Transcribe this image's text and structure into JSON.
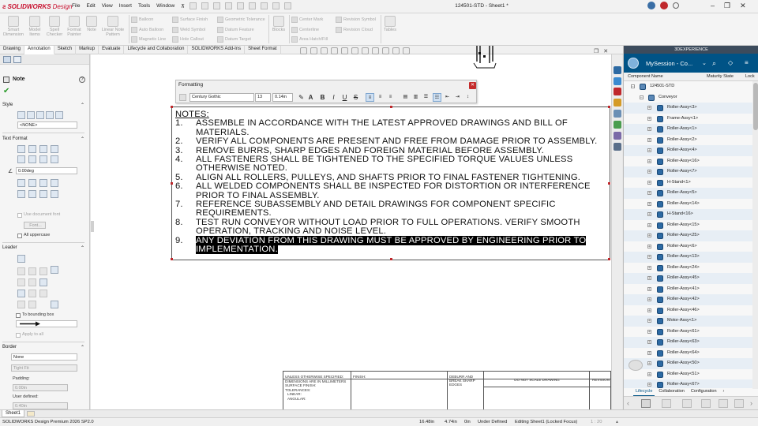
{
  "app": {
    "brand": "SOLIDWORKS",
    "brand_suffix": "Design",
    "menus": [
      "File",
      "Edit",
      "View",
      "Insert",
      "Tools",
      "Window"
    ],
    "document_title": "124501-STD - Sheet1 *"
  },
  "command_manager": {
    "buttons": [
      {
        "label": "Smart Dimension"
      },
      {
        "label": "Model Items"
      },
      {
        "label": "Spell Checker"
      },
      {
        "label": "Format Painter"
      },
      {
        "label": "Note"
      },
      {
        "label": "Linear Note Pattern"
      }
    ],
    "col1": [
      "Balloon",
      "Auto Balloon",
      "Magnetic Line"
    ],
    "col2": [
      "Surface Finish",
      "Weld Symbol",
      "Hole Callout"
    ],
    "col3": [
      "Geometric Tolerance",
      "Datum Feature",
      "Datum Target"
    ],
    "col4": [
      "Blocks"
    ],
    "col5": [
      "Center Mark",
      "Centerline",
      "Area Hatch/Fill"
    ],
    "col6": [
      "Revision Symbol",
      "Revision Cloud"
    ],
    "col7": [
      "Tables"
    ]
  },
  "tabs": [
    "Drawing",
    "Annotation",
    "Sketch",
    "Markup",
    "Evaluate",
    "Lifecycle and Collaboration",
    "SOLIDWORKS Add-Ins",
    "Sheet Format"
  ],
  "active_tab": "Annotation",
  "property_manager": {
    "title": "Note",
    "style_label": "Style",
    "style_value": "<NONE>",
    "text_format_label": "Text Format",
    "angle_value": "0.00deg",
    "use_doc_font": "Use document font",
    "font_button": "Font...",
    "all_uppercase": "All uppercase",
    "leader_label": "Leader",
    "to_bounding_box": "To bounding box",
    "apply_to_all": "Apply to all",
    "border_label": "Border",
    "border_value": "None",
    "border_size": "Tight Fit",
    "padding_label": "Padding:",
    "padding_value": "0.00in",
    "user_defined_label": "User defined:",
    "user_defined_value": "0.40in"
  },
  "formatting": {
    "title": "Formatting",
    "font": "Century Gothic",
    "size": "13",
    "height": "0.14in",
    "buttons": [
      "A",
      "B",
      "I",
      "U",
      "S"
    ]
  },
  "note": {
    "title": "NOTES:",
    "items": [
      {
        "num": "1.",
        "text": "ASSEMBLE IN ACCORDANCE WITH THE LATEST APPROVED DRAWINGS AND BILL OF MATERIALS."
      },
      {
        "num": "2.",
        "text": "VERIFY ALL COMPONENTS ARE PRESENT AND FREE FROM DAMAGE PRIOR TO ASSEMBLY."
      },
      {
        "num": "3.",
        "text": "REMOVE BURRS, SHARP EDGES AND FOREIGN MATERIAL BEFORE ASSEMBLY."
      },
      {
        "num": "4.",
        "text": "ALL FASTENERS SHALL BE TIGHTENED TO THE SPECIFIED TORQUE VALUES UNLESS OTHERWISE NOTED."
      },
      {
        "num": "5.",
        "text": "ALIGN ALL ROLLERS, PULLEYS, AND SHAFTS PRIOR TO FINAL FASTENER TIGHTENING."
      },
      {
        "num": "6.",
        "text": "ALL WELDED COMPONENTS SHALL BE INSPECTED FOR DISTORTION OR INTERFERENCE PRIOR TO FINAL ASSEMBLY."
      },
      {
        "num": "7.",
        "text": "REFERENCE SUBASSEMBLY AND DETAIL DRAWINGS FOR COMPONENT SPECIFIC REQUIREMENTS."
      },
      {
        "num": "8.",
        "text": "TEST RUN CONVEYOR WITHOUT LOAD PRIOR TO FULL OPERATIONS. VERIFY SMOOTH OPERATION, TRACKING AND NOISE LEVEL."
      },
      {
        "num": "9.",
        "text": "ANY DEVIATION FROM THIS DRAWING MUST BE APPROVED BY ENGINEERING PRIOR TO IMPLEMENTATION.",
        "selected": true
      }
    ]
  },
  "title_block": {
    "unless": "UNLESS OTHERWISE SPECIFIED:",
    "dims": "DIMENSIONS ARE IN MILLIMETERS",
    "surface": "SURFACE FINISH:",
    "tolerances": "TOLERANCES:",
    "linear": "LINEAR:",
    "angular": "ANGULAR:",
    "finish": "FINISH:",
    "deburr": "DEBURR AND BREAK SHARP EDGES",
    "do_not_scale": "DO NOT SCALE DRAWING",
    "revision": "REVISION"
  },
  "x3d": {
    "header": "3DEXPERIENCE",
    "session": "MySession - Co...",
    "col_name": "Component Name",
    "col_maturity": "Maturity State",
    "col_lock": "Lock",
    "root": "124501-STD",
    "sub": "Conveyor",
    "components": [
      "Roller-Assy<3>",
      "Frame-Assy<1>",
      "Roller-Assy<1>",
      "Roller-Assy<2>",
      "Roller-Assy<4>",
      "Roller-Assy<16>",
      "Roller-Assy<7>",
      "H-Stand<1>",
      "Roller-Assy<5>",
      "Roller-Assy<14>",
      "H-Stand<16>",
      "Roller-Assy<15>",
      "Roller-Assy<25>",
      "Roller-Assy<6>",
      "Roller-Assy<13>",
      "Roller-Assy<24>",
      "Roller-Assy<45>",
      "Roller-Assy<41>",
      "Roller-Assy<42>",
      "Roller-Assy<46>",
      "Motor-Assy<1>",
      "Roller-Assy<61>",
      "Roller-Assy<63>",
      "Roller-Assy<64>",
      "Roller-Assy<50>",
      "Roller-Assy<51>",
      "Roller-Assy<67>"
    ],
    "tabs": [
      "Lifecycle",
      "Collaboration",
      "Configuration"
    ]
  },
  "sheet_tab": "Sheet1",
  "status": {
    "product": "SOLIDWORKS Design Premium 2026 SP2.0",
    "x": "16.48in",
    "y": "4.74in",
    "z": "0in",
    "state": "Under Defined",
    "editing": "Editing Sheet1 (Locked Focus)",
    "scale": "1 : 20"
  }
}
